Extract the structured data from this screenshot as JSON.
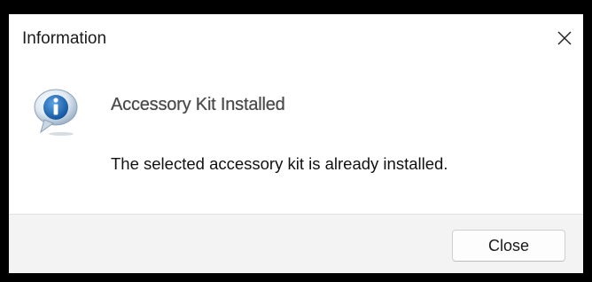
{
  "window": {
    "title": "Information",
    "close_glyph": "✕"
  },
  "message": {
    "icon": "info-icon",
    "heading": "Accessory Kit Installed",
    "body": "The selected accessory kit is already installed."
  },
  "footer": {
    "close_label": "Close"
  },
  "colors": {
    "icon_blue": "#1f6fbf",
    "heading_text": "#4a4a4a",
    "footer_bg": "#f3f3f3"
  }
}
